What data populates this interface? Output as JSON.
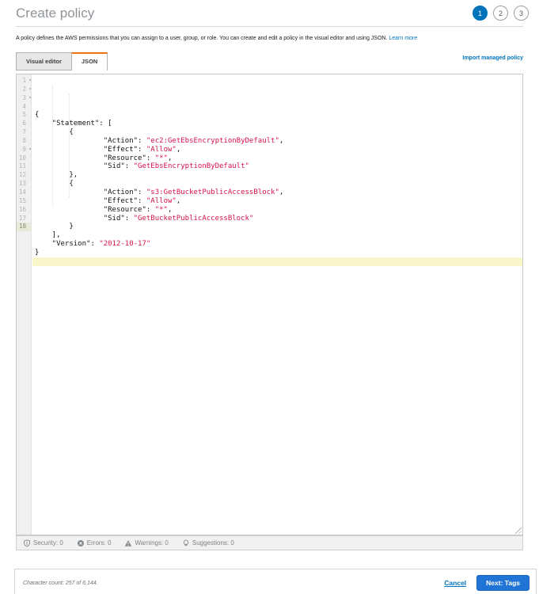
{
  "header": {
    "title": "Create policy",
    "steps": [
      {
        "label": "1",
        "active": true
      },
      {
        "label": "2",
        "active": false
      },
      {
        "label": "3",
        "active": false
      }
    ]
  },
  "intro": {
    "text": "A policy defines the AWS permissions that you can assign to a user, group, or role. You can create and edit a policy in the visual editor and using JSON. ",
    "link": "Learn more"
  },
  "tabs": [
    {
      "label": "Visual editor",
      "active": false
    },
    {
      "label": "JSON",
      "active": true
    }
  ],
  "import_link": "Import managed policy",
  "editor": {
    "lines": [
      {
        "n": "1",
        "text": "{",
        "fold": true
      },
      {
        "n": "2",
        "text": "    \"Statement\": [",
        "fold": true
      },
      {
        "n": "3",
        "text": "        {",
        "fold": true
      },
      {
        "n": "4",
        "text": "                \"Action\": \"ec2:GetEbsEncryptionByDefault\","
      },
      {
        "n": "5",
        "text": "                \"Effect\": \"Allow\","
      },
      {
        "n": "6",
        "text": "                \"Resource\": \"*\","
      },
      {
        "n": "7",
        "text": "                \"Sid\": \"GetEbsEncryptionByDefault\""
      },
      {
        "n": "8",
        "text": "        },"
      },
      {
        "n": "9",
        "text": "        {",
        "fold": true
      },
      {
        "n": "10",
        "text": "                \"Action\": \"s3:GetBucketPublicAccessBlock\","
      },
      {
        "n": "11",
        "text": "                \"Effect\": \"Allow\","
      },
      {
        "n": "12",
        "text": "                \"Resource\": \"*\","
      },
      {
        "n": "13",
        "text": "                \"Sid\": \"GetBucketPublicAccessBlock\""
      },
      {
        "n": "14",
        "text": "        }"
      },
      {
        "n": "15",
        "text": "    ],"
      },
      {
        "n": "16",
        "text": "    \"Version\": \"2012-10-17\""
      },
      {
        "n": "17",
        "text": "}"
      },
      {
        "n": "18",
        "text": "",
        "active": true
      }
    ],
    "status_items": [
      {
        "icon": "security-icon",
        "label": "Security: 0"
      },
      {
        "icon": "errors-icon",
        "label": "Errors: 0"
      },
      {
        "icon": "warnings-icon",
        "label": "Warnings: 0"
      },
      {
        "icon": "suggestions-icon",
        "label": "Suggestions: 0"
      }
    ]
  },
  "footer": {
    "character_count": "Character count: 257 of 6,144.",
    "cancel_label": "Cancel",
    "next_label": "Next: Tags"
  },
  "colors": {
    "accent_orange": "#ec7211",
    "link_blue": "#0073bb",
    "button_blue": "#2074d5",
    "step_active_blue": "#0073bb",
    "string_red": "#d6124a",
    "active_line_yellow": "#fbf7cd"
  }
}
